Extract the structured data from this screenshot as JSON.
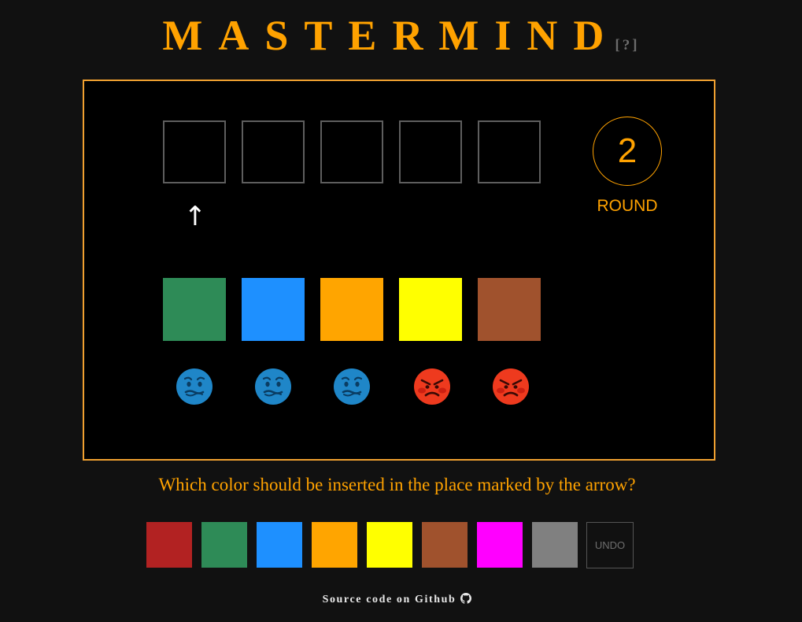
{
  "title": "MASTERMIND",
  "help_label": "[?]",
  "board": {
    "slots": [
      "",
      "",
      "",
      "",
      ""
    ],
    "arrow": "↑",
    "round_number": "2",
    "round_label": "ROUND",
    "history": {
      "colors": [
        "#2e8b57",
        "#1e90ff",
        "#ffa500",
        "#ffff00",
        "#a0522d"
      ],
      "feedback": [
        "cold-face-icon",
        "cold-face-icon",
        "cold-face-icon",
        "angry-face-icon",
        "angry-face-icon"
      ]
    }
  },
  "question": "Which color should be inserted in the place marked by the arrow?",
  "palette": {
    "colors": [
      {
        "name": "red",
        "hex": "#b22222"
      },
      {
        "name": "green",
        "hex": "#2e8b57"
      },
      {
        "name": "blue",
        "hex": "#1e90ff"
      },
      {
        "name": "orange",
        "hex": "#ffa500"
      },
      {
        "name": "yellow",
        "hex": "#ffff00"
      },
      {
        "name": "brown",
        "hex": "#a0522d"
      },
      {
        "name": "magenta",
        "hex": "#ff00ff"
      },
      {
        "name": "gray",
        "hex": "#808080"
      }
    ],
    "undo_label": "UNDO"
  },
  "footer": {
    "link_text": "Source code on Github",
    "icon": "github-icon"
  },
  "colors": {
    "accent": "#ffa200",
    "board_border": "#f0a030",
    "background": "#111111",
    "board_background": "#000000"
  }
}
